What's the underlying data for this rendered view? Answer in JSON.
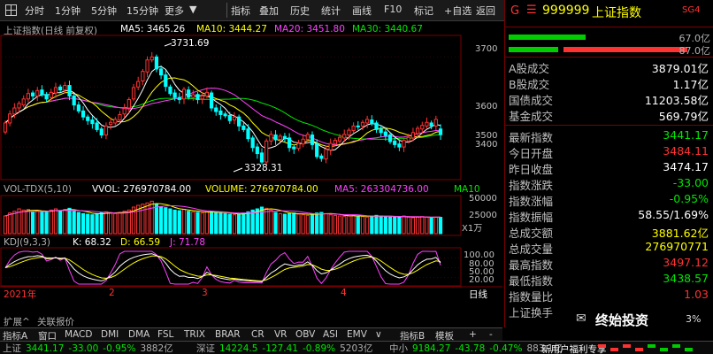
{
  "toolbar": {
    "left_icon": "grid-icon",
    "periods": [
      "分时",
      "1分钟",
      "5分钟",
      "15分钟",
      "更多"
    ],
    "tools": [
      "指标",
      "叠加",
      "历史",
      "统计",
      "画线",
      "F10",
      "标记",
      "+自选",
      "返回"
    ]
  },
  "chart": {
    "main_legend": {
      "title": "上证指数(日线 前复权)",
      "ma5": "MA5: 3465.26",
      "ma10": "MA10: 3444.27",
      "ma20": "MA20: 3451.80",
      "ma30": "MA30: 3440.67"
    },
    "vol_legend": {
      "title": "VOL-TDX(5,10)",
      "vvol": "VVOL: 276970784.00",
      "volume": "VOLUME: 276970784.00",
      "ma5": "MA5: 263304736.00",
      "ma10": "MA10"
    },
    "kdj_legend": {
      "title": "KDJ(9,3,3)",
      "k": "K: 68.32",
      "d": "D: 66.59",
      "j": "J: 71.78"
    },
    "high_label": "3731.69",
    "low_label": "3328.31",
    "price_ticks": [
      "3700",
      "3600",
      "3500",
      "3400"
    ],
    "vol_ticks": [
      "50000",
      "25000"
    ],
    "vol_unit": "X1万",
    "kdj_ticks": [
      "100.00",
      "80.00",
      "50.00",
      "20.00"
    ],
    "date_labels": [
      "2021年",
      "2",
      "3",
      "4"
    ],
    "period_label": "日线",
    "colors": {
      "up": "#ff3232",
      "down": "#00ffff",
      "ma5": "#ffffff",
      "ma10": "#ffff00",
      "ma20": "#ff40ff",
      "ma30": "#00e600"
    }
  },
  "chart_data": {
    "type": "candlestick",
    "title": "上证指数(日线 前复权)",
    "yrange": [
      3300,
      3760
    ],
    "high": 3731.69,
    "low": 3328.31,
    "x_labels": [
      "2021年",
      "2",
      "3",
      "4"
    ],
    "ohlc_open": [
      3450,
      3480,
      3510,
      3530,
      3540,
      3560,
      3580,
      3570,
      3590,
      3575,
      3565,
      3580,
      3600,
      3590,
      3605,
      3570,
      3540,
      3520,
      3500,
      3490,
      3480,
      3460,
      3440,
      3475,
      3480,
      3490,
      3510,
      3530,
      3560,
      3600,
      3620,
      3650,
      3690,
      3700,
      3660,
      3640,
      3600,
      3580,
      3565,
      3560,
      3590,
      3565,
      3575,
      3560,
      3570,
      3580,
      3530,
      3520,
      3510,
      3505,
      3490,
      3500,
      3470,
      3460,
      3430,
      3400,
      3380,
      3350,
      3420,
      3440,
      3425,
      3435,
      3430,
      3400,
      3395,
      3410,
      3425,
      3440,
      3410,
      3370,
      3360,
      3390,
      3410,
      3420,
      3430,
      3440,
      3455,
      3470,
      3470,
      3480,
      3490,
      3480,
      3460,
      3450,
      3440,
      3420,
      3410,
      3400,
      3420,
      3430,
      3445,
      3460,
      3470,
      3480,
      3470,
      3460
    ],
    "ohlc_close": [
      3480,
      3510,
      3530,
      3545,
      3560,
      3578,
      3570,
      3588,
      3575,
      3560,
      3582,
      3598,
      3590,
      3605,
      3570,
      3540,
      3520,
      3500,
      3488,
      3478,
      3458,
      3440,
      3470,
      3482,
      3492,
      3508,
      3528,
      3558,
      3598,
      3618,
      3652,
      3690,
      3700,
      3660,
      3640,
      3602,
      3578,
      3565,
      3558,
      3592,
      3566,
      3574,
      3558,
      3570,
      3582,
      3530,
      3518,
      3508,
      3504,
      3488,
      3500,
      3470,
      3458,
      3428,
      3398,
      3378,
      3350,
      3420,
      3442,
      3424,
      3436,
      3428,
      3398,
      3394,
      3412,
      3426,
      3442,
      3408,
      3368,
      3362,
      3392,
      3412,
      3422,
      3432,
      3442,
      3456,
      3470,
      3468,
      3482,
      3492,
      3478,
      3458,
      3448,
      3438,
      3418,
      3408,
      3400,
      3422,
      3432,
      3448,
      3462,
      3472,
      3482,
      3470,
      3492,
      3441
    ],
    "vol_values": [
      30000,
      35000,
      38000,
      42000,
      40000,
      41000,
      37000,
      39000,
      36000,
      38000,
      40000,
      42000,
      39000,
      41000,
      43000,
      38000,
      36000,
      34000,
      33000,
      32000,
      34000,
      36000,
      37000,
      35000,
      34000,
      36000,
      38000,
      40000,
      45000,
      48000,
      50000,
      52000,
      55000,
      50000,
      46000,
      44000,
      42000,
      40000,
      39000,
      41000,
      38000,
      37000,
      36000,
      35000,
      37000,
      38000,
      36000,
      35000,
      34000,
      33000,
      32000,
      33000,
      35000,
      37000,
      40000,
      42000,
      45000,
      43000,
      40000,
      36000,
      34000,
      33000,
      34000,
      35000,
      33000,
      32000,
      31000,
      33000,
      35000,
      36000,
      34000,
      32000,
      31000,
      30000,
      29000,
      30000,
      31000,
      30000,
      29000,
      28000,
      30000,
      31000,
      30000,
      29000,
      28000,
      28000,
      29000,
      30000,
      28000,
      27000,
      28000,
      29000,
      28000,
      27000,
      27700,
      27697
    ],
    "vol_range": [
      0,
      60000
    ],
    "kdj_range": [
      0,
      100
    ],
    "kdj": {
      "K": 68.32,
      "D": 66.59,
      "J": 71.78
    }
  },
  "sidebar": {
    "code": "999999",
    "name": "上证指数",
    "tag": "SG4",
    "menu_icon": "menu-icon",
    "g_label": "G",
    "bar1_value": "67.0亿",
    "bar2_value": "87.0亿",
    "bar1_fill": 0.45,
    "bar2_fill_red": 0.72,
    "turnover": [
      {
        "label": "A股成交",
        "value": "3879.01亿"
      },
      {
        "label": "B股成交",
        "value": "1.17亿"
      },
      {
        "label": "国债成交",
        "value": "11203.58亿"
      },
      {
        "label": "基金成交",
        "value": "569.79亿"
      }
    ],
    "stats": [
      {
        "label": "最新指数",
        "value": "3441.17",
        "color": "green"
      },
      {
        "label": "今日开盘",
        "value": "3484.11",
        "color": "red"
      },
      {
        "label": "昨日收盘",
        "value": "3474.17",
        "color": "white"
      },
      {
        "label": "指数涨跌",
        "value": "-33.00",
        "color": "green"
      },
      {
        "label": "指数涨幅",
        "value": "-0.95%",
        "color": "green"
      },
      {
        "label": "指数振幅",
        "value": "58.55/1.69%",
        "color": "white"
      },
      {
        "label": "总成交额",
        "value": "3881.62亿",
        "color": "yellow"
      },
      {
        "label": "总成交量",
        "value": "276970771",
        "color": "yellow"
      },
      {
        "label": "最高指数",
        "value": "3497.12",
        "color": "red"
      },
      {
        "label": "最低指数",
        "value": "3438.57",
        "color": "green"
      },
      {
        "label": "指数量比",
        "value": "1.03",
        "color": "red"
      },
      {
        "label": "上证换手",
        "value": "",
        "color": "white"
      }
    ],
    "watermark": "终始投资",
    "watermark_suffix": "3%"
  },
  "indicator_bar": {
    "items": [
      "指标A",
      "窗口",
      "MACD",
      "DMI",
      "DMA",
      "FSL",
      "TRIX",
      "BRAR",
      "CR",
      "VR",
      "OBV",
      "ASI",
      "EMV"
    ],
    "more": "∨",
    "right_items": [
      "指标B",
      "模板",
      "+",
      "-"
    ]
  },
  "sub_bar": {
    "items": [
      "扩展^",
      "关联报价"
    ]
  },
  "status_bar": {
    "sh": {
      "name": "上证",
      "price": "3441.17",
      "chg": "-33.00",
      "pct": "-0.95%",
      "amt": "3882亿"
    },
    "sz": {
      "name": "深证",
      "price": "14224.5",
      "chg": "-127.41",
      "pct": "-0.89%",
      "amt": "5203亿"
    },
    "zx": {
      "name": "中小",
      "price": "9184.27",
      "chg": "-43.78",
      "pct": "-0.47%",
      "amt": "883.1亿"
    },
    "news": "新用户福利专享"
  }
}
